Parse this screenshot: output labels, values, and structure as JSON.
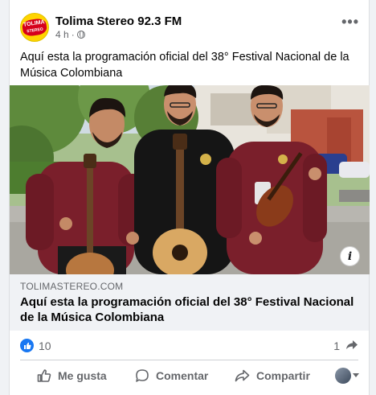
{
  "post": {
    "page_name": "Tolima Stereo 92.3 FM",
    "time": "4 h",
    "separator": "·",
    "visibility_icon": "globe-icon",
    "more_icon": "more-horizontal-icon",
    "more_glyph": "•••",
    "text": "Aquí esta la programación oficial del 38° Festival Nacional de la Música Colombiana",
    "avatar_logo": {
      "top": "TOLIMA",
      "bottom": "STEREO"
    }
  },
  "link": {
    "domain": "TOLIMASTEREO.COM",
    "title": "Aquí esta la programación oficial del 38° Festival Nacional de la Música Colombiana",
    "info_glyph": "i"
  },
  "reactions": {
    "like_count": "10",
    "share_count": "1"
  },
  "actions": {
    "like_label": "Me gusta",
    "comment_label": "Comentar",
    "share_label": "Compartir"
  },
  "colors": {
    "accent": "#1877f2",
    "secondary_text": "#65676b",
    "background": "#f0f2f5",
    "shirt": "#7a1f2b"
  }
}
